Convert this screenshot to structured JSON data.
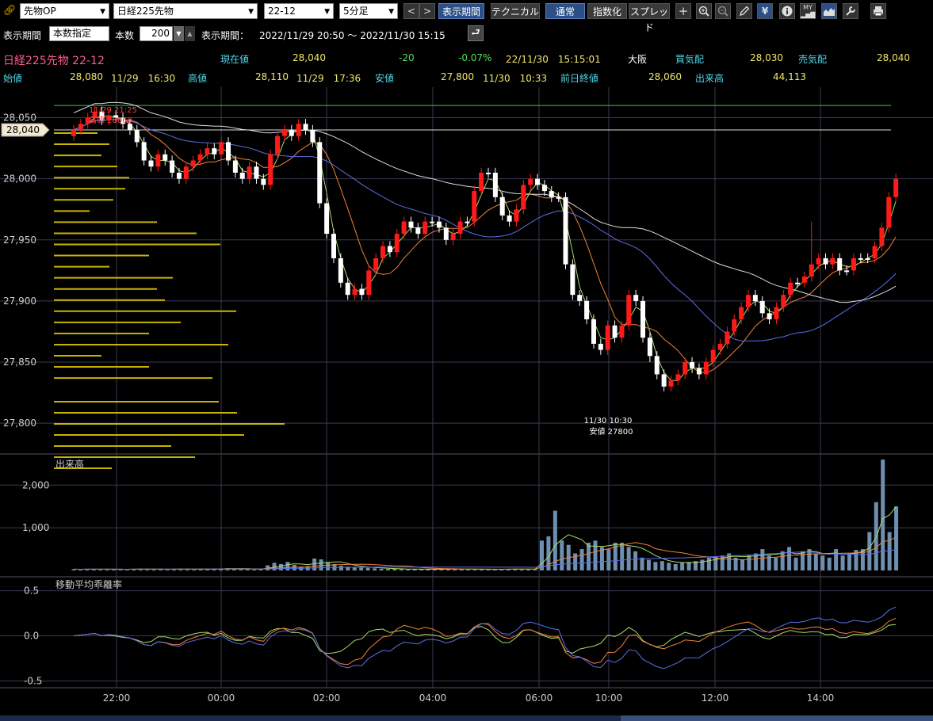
{
  "toolbar": {
    "link_icon": "link-icon",
    "market_select": "先物OP",
    "instrument_select": "日経225先物",
    "contract_select": "22-12",
    "interval_select": "5分足",
    "prev_label": "<",
    "next_label": ">",
    "period_button": "表示期間",
    "technical_button": "テクニカル",
    "normal_button": "通常",
    "index_button": "指数化",
    "spread_button": "スプレッド"
  },
  "row2": {
    "period_label": "表示期間",
    "count_mode": "本数指定",
    "count_label": "本数",
    "count_value": "200",
    "period_range_label": "表示期間：",
    "period_range": "2022/11/29 20:50 ～ 2022/11/30 15:15"
  },
  "quote": {
    "title": "日経225先物 22-12",
    "current_label": "現在値",
    "current_value": "28,040",
    "change": "-20",
    "change_pct": "-0.07%",
    "datetime": "22/11/30　15:15:01",
    "exchange": "大阪",
    "bid_label": "買気配",
    "bid_value": "28,030",
    "ask_label": "売気配",
    "ask_value": "28,040",
    "open_label": "始値",
    "open_value": "28,080",
    "open_time": "11/29　16:30",
    "high_label": "高値",
    "high_value": "28,110",
    "high_time": "11/29　17:36",
    "low_label": "安値",
    "low_value": "27,800",
    "low_time": "11/30　10:33",
    "prev_close_label": "前日終値",
    "prev_close_value": "28,060",
    "volume_label": "出来高",
    "volume_value": "44,113"
  },
  "colors": {
    "up": "#ff1a1a",
    "down": "#ffffff",
    "ma_short": "#a6d96a",
    "ma_mid": "#f0823a",
    "ma_long": "#5b6ee8",
    "ma_white": "#dddddd",
    "grid": "#3a3a55",
    "volume_bar": "#6e8fb0",
    "profile": "#c8b400"
  },
  "chart_data": [
    {
      "type": "candlestick",
      "title": "",
      "x_tick_labels": [
        "22:00",
        "00:00",
        "02:00",
        "04:00",
        "06:00",
        "10:00",
        "12:00",
        "14:00"
      ],
      "y_tick_labels": [
        "28,050",
        "28,000",
        "27,950",
        "27,900",
        "27,850",
        "27,800"
      ],
      "ylim": [
        27780,
        28075
      ],
      "current_price_label": "28,040",
      "high_annotation": [
        "11/29 21:25",
        "高値 28060"
      ],
      "low_annotation": [
        "11/30 10:30",
        "安値 27800"
      ],
      "close_series": [
        28040,
        28045,
        28050,
        28055,
        28048,
        28052,
        28050,
        28045,
        28040,
        28030,
        28015,
        28010,
        28020,
        28015,
        28005,
        28000,
        28010,
        28015,
        28020,
        28025,
        28020,
        28030,
        28015,
        28005,
        28000,
        28010,
        28000,
        27995,
        28020,
        28035,
        28040,
        28035,
        28045,
        28040,
        28030,
        27980,
        27955,
        27935,
        27915,
        27905,
        27910,
        27905,
        27925,
        27935,
        27945,
        27940,
        27955,
        27965,
        27960,
        27955,
        27965,
        27965,
        27960,
        27950,
        27955,
        27965,
        27965,
        27990,
        28005,
        28005,
        27985,
        27970,
        27965,
        27975,
        27995,
        28000,
        27995,
        27990,
        27985,
        27985,
        27930,
        27905,
        27900,
        27885,
        27865,
        27860,
        27880,
        27870,
        27880,
        27905,
        27900,
        27870,
        27855,
        27840,
        27830,
        27835,
        27840,
        27850,
        27845,
        27840,
        27850,
        27860,
        27865,
        27875,
        27885,
        27895,
        27905,
        27900,
        27890,
        27885,
        27895,
        27905,
        27915,
        27915,
        27920,
        27930,
        27935,
        27930,
        27935,
        27925,
        27925,
        27935,
        27935,
        27935,
        27945,
        27960,
        27985,
        28000
      ]
    },
    {
      "type": "bar",
      "title": "出来高",
      "y_tick_labels": [
        "2,000",
        "1,000"
      ],
      "ylim": [
        0,
        2600
      ],
      "values": [
        30,
        25,
        35,
        30,
        25,
        30,
        28,
        30,
        25,
        35,
        40,
        30,
        28,
        25,
        30,
        40,
        35,
        30,
        28,
        30,
        35,
        40,
        45,
        50,
        40,
        35,
        30,
        25,
        30,
        120,
        180,
        150,
        200,
        130,
        90,
        100,
        280,
        260,
        200,
        150,
        110,
        90,
        80,
        70,
        60,
        50,
        40,
        35,
        40,
        30,
        25,
        30,
        35,
        30,
        25,
        30,
        35,
        40,
        30,
        25,
        30,
        28,
        30,
        25,
        30,
        35,
        40,
        30,
        28,
        30,
        700,
        800,
        1400,
        700,
        600,
        400,
        500,
        650,
        700,
        550,
        500,
        650,
        650,
        550,
        450,
        300,
        250,
        200,
        220,
        180,
        150,
        180,
        200,
        220,
        250,
        300,
        320,
        350,
        400,
        300,
        250,
        350,
        400,
        500,
        350,
        300,
        450,
        550,
        300,
        450,
        500,
        400,
        350,
        300,
        500,
        350,
        400,
        480,
        500,
        900,
        1600,
        2600,
        900,
        1500
      ]
    },
    {
      "type": "line",
      "title": "移動平均乖離率",
      "y_tick_labels": [
        "0.5",
        "0.0",
        "-0.5"
      ],
      "ylim": [
        -0.55,
        0.55
      ]
    }
  ]
}
